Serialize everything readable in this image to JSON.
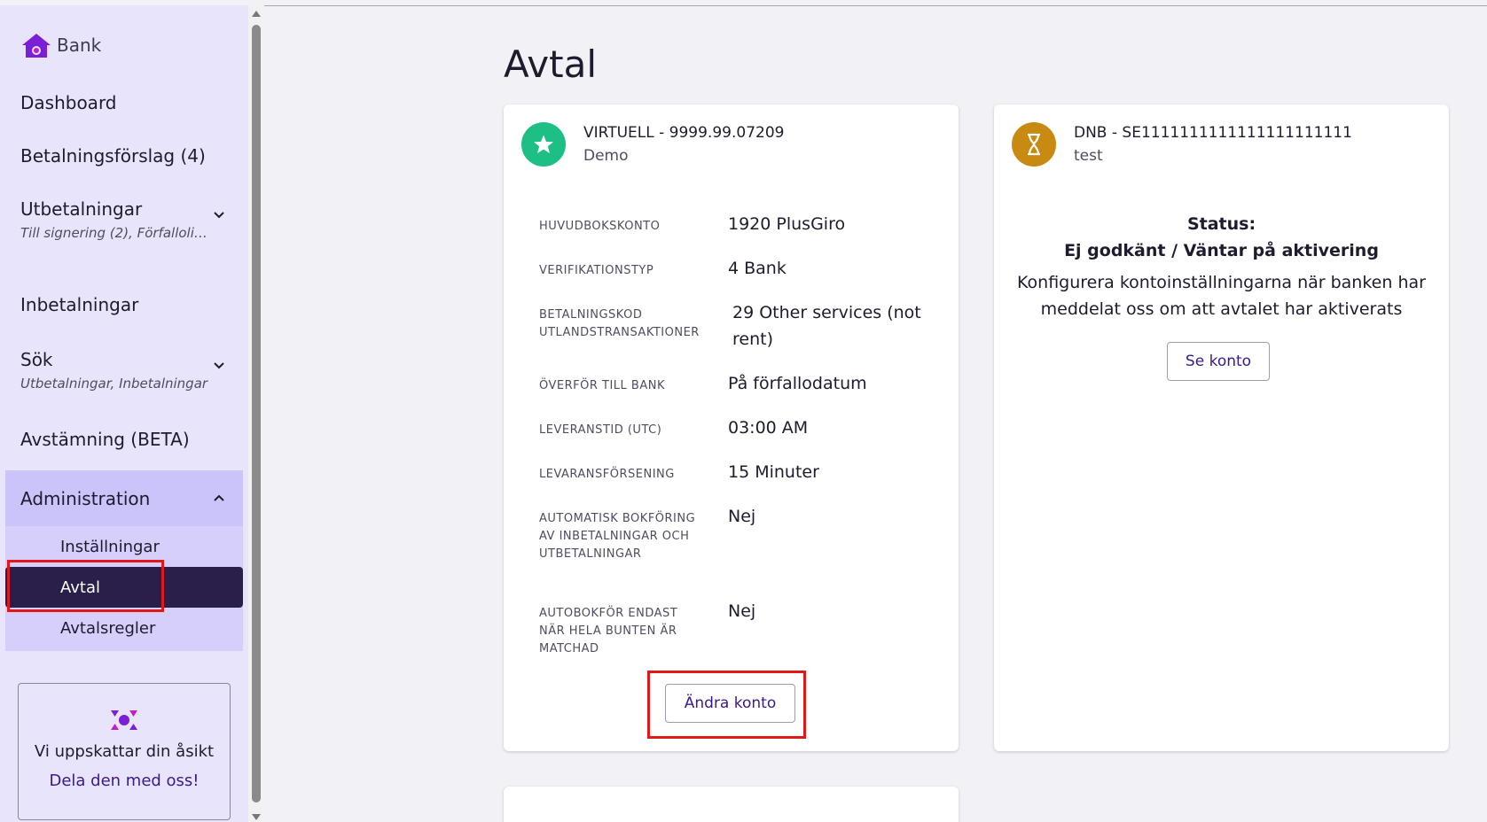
{
  "brand": {
    "label": "Bank"
  },
  "sidebar": {
    "items": [
      {
        "label": "Dashboard"
      },
      {
        "label": "Betalningsförslag (4)"
      },
      {
        "label": "Utbetalningar",
        "sub": "Till signering (2), Förfallolist..."
      },
      {
        "label": "Inbetalningar"
      },
      {
        "label": "Sök",
        "sub": "Utbetalningar, Inbetalningar"
      },
      {
        "label": "Avstämning (BETA)"
      }
    ],
    "admin": {
      "label": "Administration",
      "items": [
        {
          "label": "Inställningar"
        },
        {
          "label": "Avtal",
          "active": true
        },
        {
          "label": "Avtalsregler"
        }
      ]
    }
  },
  "feedback": {
    "text": "Vi uppskattar din åsikt",
    "link": "Dela den med oss!"
  },
  "page": {
    "title": "Avtal"
  },
  "card1": {
    "title": "VIRTUELL - 9999.99.07209",
    "subtitle": "Demo",
    "icon": "star-icon",
    "icon_color": "#1dbf85",
    "rows": [
      {
        "label": "HUVUDBOKSKONTO",
        "value": "1920 PlusGiro"
      },
      {
        "label": "VERIFIKATIONSTYP",
        "value": "4 Bank"
      },
      {
        "label": "BETALNINGSKOD UTLANDSTRANSAKTIONER",
        "value": "29 Other services (not rent)"
      },
      {
        "label": "ÖVERFÖR TILL BANK",
        "value": "På förfallodatum"
      },
      {
        "label": "LEVERANSTID (UTC)",
        "value": "03:00 AM"
      },
      {
        "label": "LEVARANSFÖRSENING",
        "value": "15 Minuter"
      },
      {
        "label": "AUTOMATISK BOKFÖRING AV INBETALNINGAR OCH UTBETALNINGAR",
        "value": "Nej"
      },
      {
        "label": "AUTOBOKFÖR ENDAST NÄR HELA BUNTEN ÄR MATCHAD",
        "value": "Nej"
      }
    ],
    "button": "Ändra konto"
  },
  "card2": {
    "title": "DNB - SE1111111111111111111111",
    "subtitle": "test",
    "icon": "hourglass-icon",
    "icon_color": "#c98a12",
    "status_label": "Status:",
    "status_value": "Ej godkänt / Väntar på aktivering",
    "message": "Konfigurera kontoinställningarna när banken har meddelat oss om att avtalet har aktiverats",
    "button": "Se konto"
  },
  "colors": {
    "accent": "#2a1f4a",
    "sidebar_bg": "#e8e4fc",
    "highlight": "#e01818",
    "link": "#3b1a8a"
  }
}
